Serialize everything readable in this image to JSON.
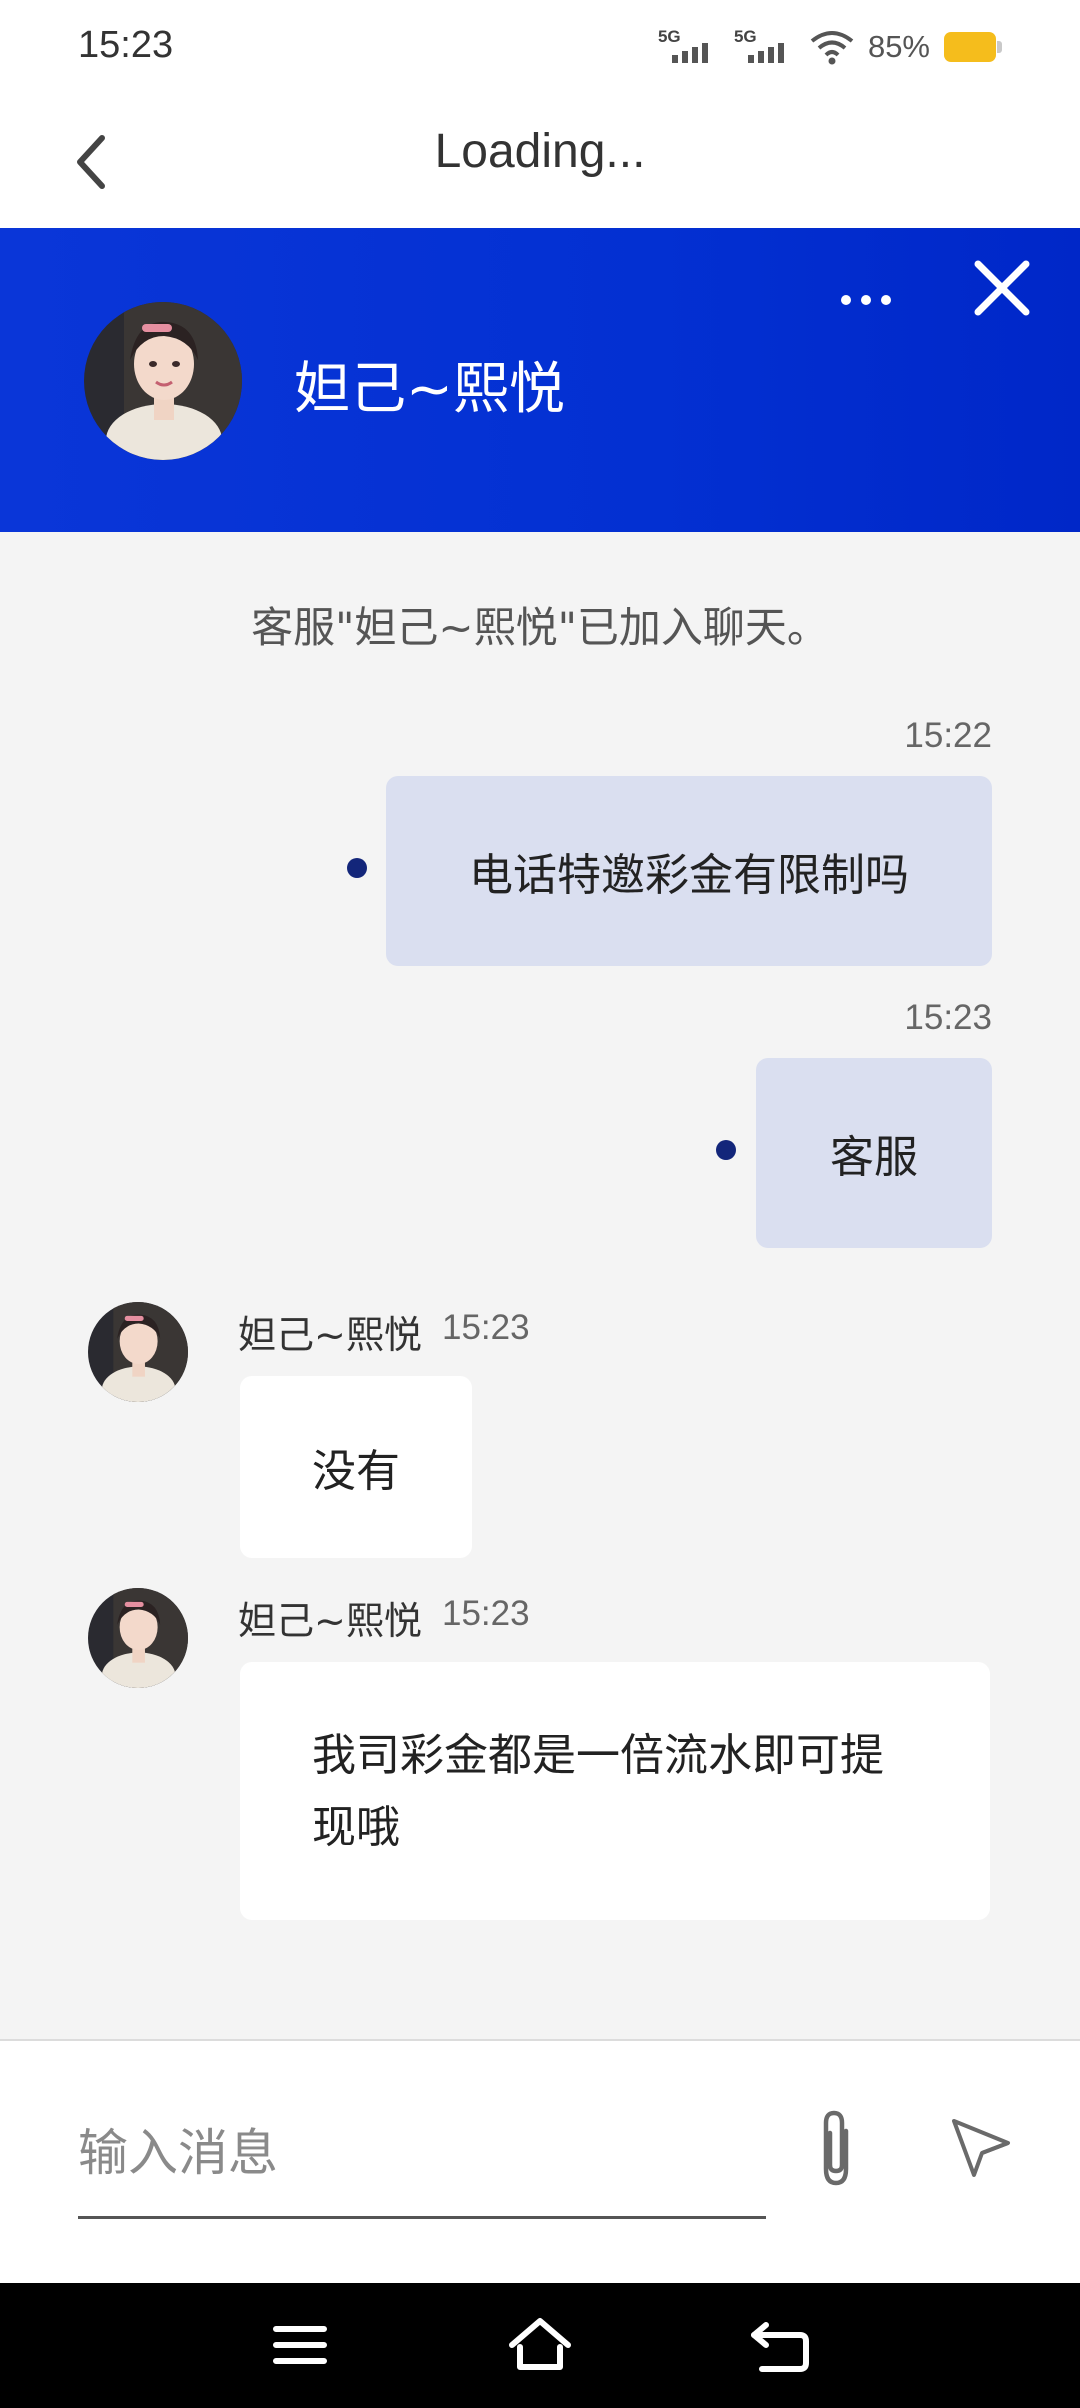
{
  "status_bar": {
    "time": "15:23",
    "signal_1": "5G",
    "signal_2": "5G",
    "battery_percent": "85%",
    "battery_level": 0.85,
    "battery_color": "#f5bd1c"
  },
  "nav": {
    "title": "Loading..."
  },
  "chat_header": {
    "agent_name": "妲己~熙悦",
    "background_color": "#0a36d8"
  },
  "chat": {
    "system_notice": "客服\"妲己~熙悦\"已加入聊天。",
    "messages": [
      {
        "direction": "outgoing",
        "time": "15:22",
        "text": "电话特邀彩金有限制吗"
      },
      {
        "direction": "outgoing",
        "time": "15:23",
        "text": "客服"
      },
      {
        "direction": "incoming",
        "sender": "妲己~熙悦",
        "time": "15:23",
        "text": "没有"
      },
      {
        "direction": "incoming",
        "sender": "妲己~熙悦",
        "time": "15:23",
        "text_line1": "我司彩金都是一倍流水即可提",
        "text_line2": "现哦"
      }
    ]
  },
  "input": {
    "placeholder": "输入消息",
    "value": ""
  },
  "icons": {
    "back": "chevron-left-icon",
    "more": "more-dots-icon",
    "close": "close-icon",
    "attach": "paperclip-icon",
    "send": "send-icon",
    "menu": "menu-icon",
    "home": "home-icon",
    "return": "back-return-icon"
  }
}
